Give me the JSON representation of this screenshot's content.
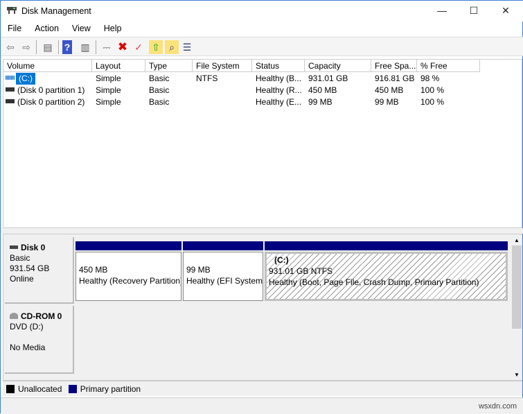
{
  "window": {
    "title": "Disk Management",
    "minimize": "—",
    "maximize": "☐",
    "close": "✕"
  },
  "menu": [
    "File",
    "Action",
    "View",
    "Help"
  ],
  "toolbar": [
    {
      "icon": "back-icon",
      "g": "⇦"
    },
    {
      "icon": "forward-icon",
      "g": "⇨"
    },
    {
      "icon": "show-hide-console-tree-icon",
      "g": "▤"
    },
    {
      "icon": "help-icon",
      "g": "?"
    },
    {
      "icon": "show-hide-action-pane-icon",
      "g": "▥"
    },
    {
      "icon": "connect-disk-icon",
      "g": "⎓"
    },
    {
      "icon": "delete-icon",
      "g": "✖"
    },
    {
      "icon": "properties-icon",
      "g": "✓"
    },
    {
      "icon": "open-icon",
      "g": "⇧"
    },
    {
      "icon": "explore-icon",
      "g": "⌕"
    },
    {
      "icon": "settings-list-icon",
      "g": "☰"
    }
  ],
  "columns": [
    "Volume",
    "Layout",
    "Type",
    "File System",
    "Status",
    "Capacity",
    "Free Spa...",
    "% Free"
  ],
  "rows": [
    [
      "(C:)",
      "Simple",
      "Basic",
      "NTFS",
      "Healthy (B...",
      "931.01 GB",
      "916.81 GB",
      "98 %"
    ],
    [
      "(Disk 0 partition 1)",
      "Simple",
      "Basic",
      "",
      "Healthy (R...",
      "450 MB",
      "450 MB",
      "100 %"
    ],
    [
      "(Disk 0 partition 2)",
      "Simple",
      "Basic",
      "",
      "Healthy (E...",
      "99 MB",
      "99 MB",
      "100 %"
    ]
  ],
  "disks": [
    {
      "name": "Disk 0",
      "type": "Basic",
      "size": "931.54 GB",
      "status": "Online",
      "partitions": [
        {
          "title": "",
          "size": "450 MB",
          "status": "Healthy (Recovery Partition)"
        },
        {
          "title": "",
          "size": "99 MB",
          "status": "Healthy (EFI System Partition)"
        },
        {
          "title": "(C:)",
          "size": "931.01 GB NTFS",
          "status": "Healthy (Boot, Page File, Crash Dump, Primary Partition)"
        }
      ]
    },
    {
      "name": "CD-ROM 0",
      "type": "DVD (D:)",
      "status": "No Media"
    }
  ],
  "legend": [
    {
      "label": "Unallocated",
      "color": "#000000"
    },
    {
      "label": "Primary partition",
      "color": "#000080"
    }
  ],
  "watermark": "wsxdn.com"
}
